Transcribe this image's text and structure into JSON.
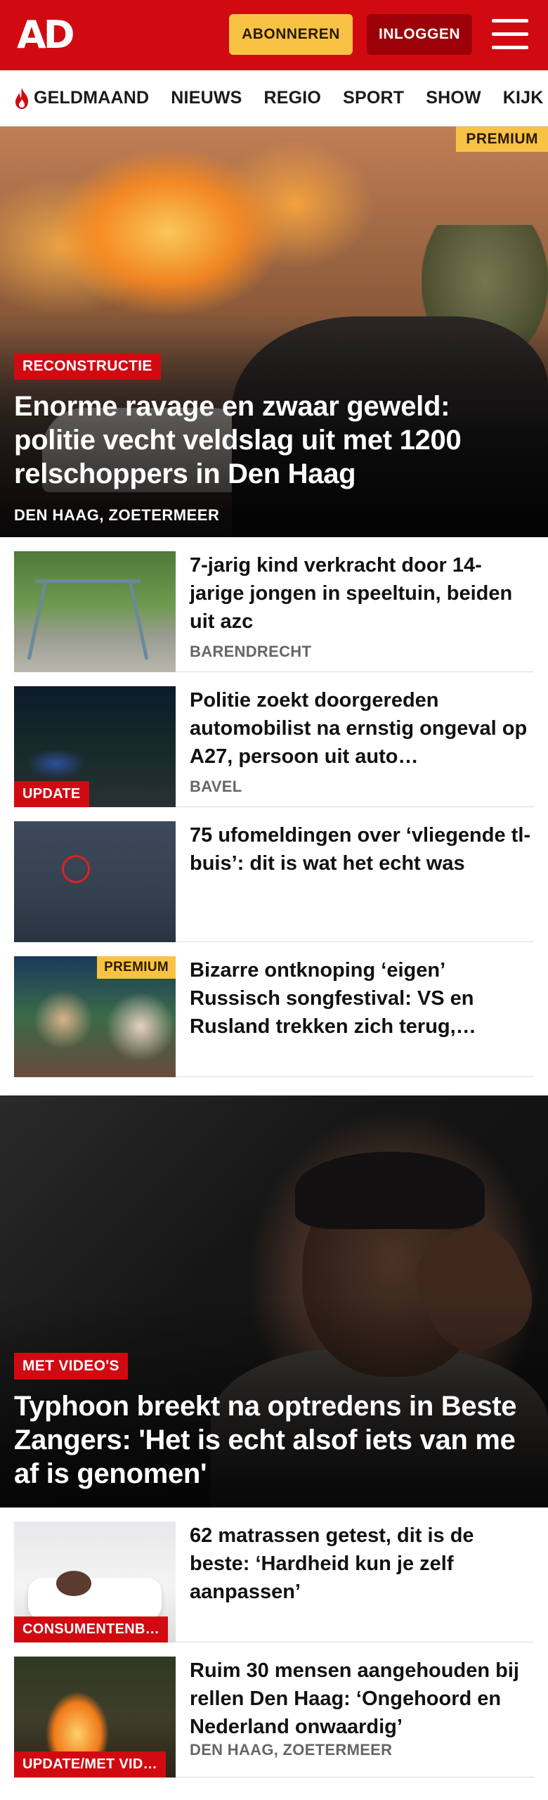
{
  "header": {
    "logo": "AD",
    "subscribe_label": "ABONNEREN",
    "login_label": "INLOGGEN",
    "brand_color": "#d10a11"
  },
  "nav": {
    "items": [
      {
        "label": "GELDMAAND",
        "icon": "flame-icon"
      },
      {
        "label": "NIEUWS"
      },
      {
        "label": "REGIO"
      },
      {
        "label": "SPORT"
      },
      {
        "label": "SHOW"
      },
      {
        "label": "KIJK"
      }
    ]
  },
  "hero": {
    "badge": "PREMIUM",
    "label": "RECONSTRUCTIE",
    "title": "Enorme ravage en zwaar geweld: politie vecht veldslag uit met 1200 relschoppers in Den Haag",
    "location": "DEN HAAG, ZOETERMEER"
  },
  "articles": [
    {
      "title": "7-jarig kind verkracht door 14-jarige jongen in speeltuin, beiden uit azc",
      "location": "BARENDRECHT"
    },
    {
      "title": "Politie zoekt doorgereden automobilist na ernstig ongeval op A27, persoon uit auto…",
      "location": "BAVEL",
      "label": "UPDATE"
    },
    {
      "title": "75 ufomeldingen over ‘vliegende tl-buis’: dit is wat het echt was"
    },
    {
      "title": "Bizarre ontknoping ‘eigen’ Russisch songfestival: VS en Rusland trekken zich terug,…",
      "badge": "PREMIUM"
    }
  ],
  "hero2": {
    "label": "MET VIDEO'S",
    "title": "Typhoon breekt na optredens in Beste Zangers: 'Het is echt alsof iets van me af is genomen'"
  },
  "articles2": [
    {
      "title": "62 matrassen getest, dit is de beste: ‘Hardheid kun je zelf aanpassen’",
      "label": "CONSUMENTENB…"
    },
    {
      "title": "Ruim 30 mensen aangehouden bij rellen Den Haag: ‘Ongehoord en Nederland onwaardig’",
      "location": "DEN HAAG, ZOETERMEER",
      "label": "UPDATE/MET VID…"
    }
  ]
}
